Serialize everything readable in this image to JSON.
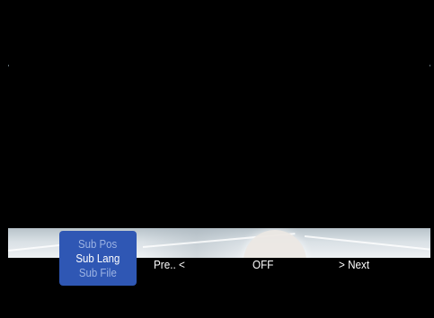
{
  "subtitle_menu": {
    "items": [
      {
        "label": "Sub Pos",
        "state": "dim"
      },
      {
        "label": "Sub Lang",
        "state": "active"
      },
      {
        "label": "Sub File",
        "state": "dim"
      }
    ]
  },
  "option_bar": {
    "prev_label": "Pre.. <",
    "value": "OFF",
    "next_label": "> Next"
  },
  "colors": {
    "background": "#000000",
    "menu_panel": "#2f57b4",
    "menu_text_dim": "#9cb3e3",
    "text": "#ffffff"
  }
}
